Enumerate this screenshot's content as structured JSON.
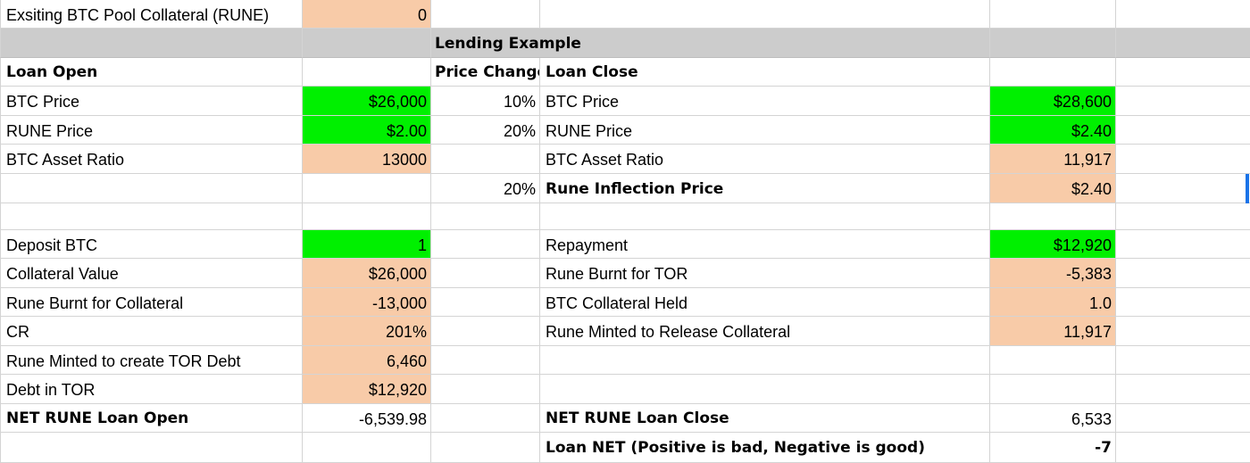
{
  "sheet": {
    "title": "Lending Example",
    "existing_pool": {
      "label": "Exsiting BTC Pool Collateral (RUNE)",
      "value": "0"
    },
    "left": {
      "header": "Loan Open",
      "btc_price": {
        "label": "BTC Price",
        "value": "$26,000"
      },
      "rune_price": {
        "label": "RUNE Price",
        "value": "$2.00"
      },
      "asset_ratio": {
        "label": "BTC Asset Ratio",
        "value": "13000"
      },
      "deposit": {
        "label": "Deposit BTC",
        "value": "1"
      },
      "collateral_value": {
        "label": "Collateral Value",
        "value": "$26,000"
      },
      "rune_burnt": {
        "label": "Rune Burnt for Collateral",
        "value": "-13,000"
      },
      "cr": {
        "label": "CR",
        "value": "201%"
      },
      "rune_minted": {
        "label": "Rune Minted to create TOR Debt",
        "value": "6,460"
      },
      "debt": {
        "label": "Debt in TOR",
        "value": "$12,920"
      },
      "net": {
        "label": "NET RUNE Loan Open",
        "value": "-6,539.98"
      }
    },
    "middle": {
      "header": "Price Change",
      "btc_change": "10%",
      "rune_change": "20%",
      "inflection_change": "20%"
    },
    "right": {
      "header": "Loan Close",
      "btc_price": {
        "label": "BTC Price",
        "value": "$28,600"
      },
      "rune_price": {
        "label": "RUNE Price",
        "value": "$2.40"
      },
      "asset_ratio": {
        "label": "BTC Asset Ratio",
        "value": "11,917"
      },
      "inflection": {
        "label": "Rune Inflection Price",
        "value": "$2.40"
      },
      "repayment": {
        "label": "Repayment",
        "value": "$12,920"
      },
      "rune_burnt_tor": {
        "label": "Rune Burnt for TOR",
        "value": "-5,383"
      },
      "collateral_held": {
        "label": "BTC Collateral Held",
        "value": "1.0"
      },
      "rune_minted_release": {
        "label": "Rune Minted to Release Collateral",
        "value": "11,917"
      },
      "net": {
        "label": "NET RUNE Loan Close",
        "value": "6,533"
      },
      "loan_net": {
        "label": "Loan NET (Positive is bad, Negative is good)",
        "value": "-7"
      }
    }
  },
  "colors": {
    "input_green": "#00f000",
    "calc_orange": "#f8cba8",
    "header_gray": "#cccccc",
    "selection_blue": "#1a73e8"
  }
}
